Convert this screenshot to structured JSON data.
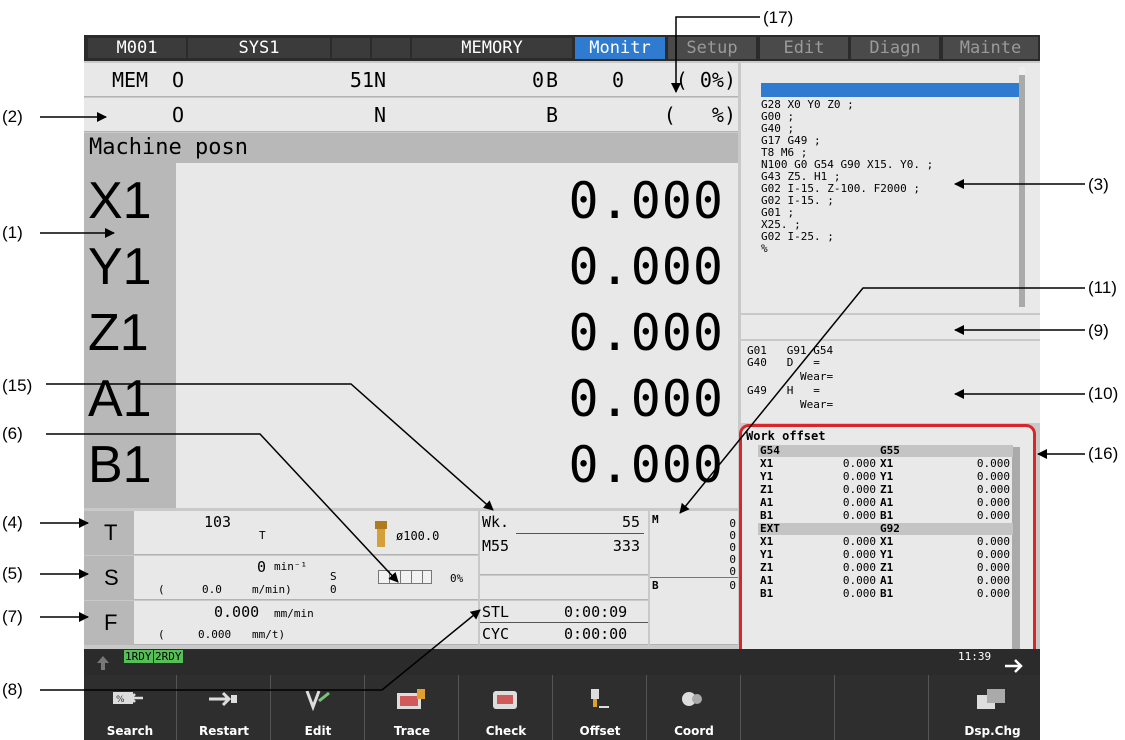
{
  "callouts": [
    "(1)",
    "(2)",
    "(3)",
    "(4)",
    "(5)",
    "(6)",
    "(7)",
    "(8)",
    "(9)",
    "(10)",
    "(11)",
    "(15)",
    "(16)",
    "(17)"
  ],
  "topbar": {
    "machine": "M001",
    "system": "SYS1",
    "mode": "MEMORY",
    "tabs": [
      "Monitr",
      "Setup",
      "Edit",
      "Diagn",
      "Mainte"
    ],
    "active_tab": "Monitr"
  },
  "program_rows": [
    {
      "label": "MEM",
      "o_label": "O",
      "o_value": "51",
      "n_label": "N",
      "n_value": "0",
      "b_label": "B",
      "b_value": "0",
      "pct": "( 0%)"
    },
    {
      "label": "",
      "o_label": "O",
      "o_value": "",
      "n_label": "N",
      "n_value": "",
      "b_label": "B",
      "b_value": "",
      "pct": "(   %)"
    }
  ],
  "position": {
    "title": "Machine posn",
    "axes": [
      {
        "name": "X1",
        "value": "0.000"
      },
      {
        "name": "Y1",
        "value": "0.000"
      },
      {
        "name": "Z1",
        "value": "0.000"
      },
      {
        "name": "A1",
        "value": "0.000"
      },
      {
        "name": "B1",
        "value": "0.000"
      }
    ]
  },
  "tool": {
    "label": "T",
    "value": "103",
    "sub": "T",
    "diameter": "ø100.0"
  },
  "spindle": {
    "label": "S",
    "value": "0",
    "unit": "min⁻¹",
    "paren": "(",
    "speed": "0.0",
    "speed_unit": "m/min)",
    "s_sub": "S",
    "s_val": "0",
    "load_pct": "0%",
    "load_fraction": 0.0
  },
  "feed": {
    "label": "F",
    "value": "0.000",
    "unit": "mm/min",
    "paren": "(",
    "per_rev": "0.000",
    "per_rev_unit": "mm/t)"
  },
  "counters": {
    "wk_label": "Wk.",
    "wk_value": "55",
    "m55_label": "M55",
    "m55_value": "333"
  },
  "mcodes": {
    "m_label": "M",
    "b_label": "B",
    "m_values": [
      "0",
      "0",
      "0",
      "0",
      "0"
    ],
    "b_value": "0"
  },
  "time": {
    "stl_label": "STL",
    "stl_value": "0:00:09",
    "cyc_label": "CYC",
    "cyc_value": "0:00:00"
  },
  "status": {
    "ready1": "1RDY",
    "ready2": "2RDY",
    "clock": "11:39"
  },
  "program_lines": [
    "G28 X0 Y0 Z0 ;",
    "G00 ;",
    "G40 ;",
    "G17 G49 ;",
    "T8 M6 ;",
    "N100 G0 G54 G90 X15. Y0. ;",
    "G43 Z5. H1 ;",
    "G02 I-15. Z-100. F2000 ;",
    "G02 I-15. ;",
    "G01 ;",
    "X25. ;",
    "G02 I-25. ;",
    "%"
  ],
  "modal": {
    "line1": "G01   G91 G54",
    "line2": "G40   D   =",
    "line3": "        Wear=",
    "line4": "G49   H   =",
    "line5": "        Wear="
  },
  "work_offset": {
    "title": "Work offset",
    "groups": [
      {
        "left": "G54",
        "right": "G55",
        "rows": [
          [
            "X1",
            "0.000",
            "X1",
            "0.000"
          ],
          [
            "Y1",
            "0.000",
            "Y1",
            "0.000"
          ],
          [
            "Z1",
            "0.000",
            "Z1",
            "0.000"
          ],
          [
            "A1",
            "0.000",
            "A1",
            "0.000"
          ],
          [
            "B1",
            "0.000",
            "B1",
            "0.000"
          ]
        ]
      },
      {
        "left": "EXT",
        "right": "G92",
        "rows": [
          [
            "X1",
            "0.000",
            "X1",
            "0.000"
          ],
          [
            "Y1",
            "0.000",
            "Y1",
            "0.000"
          ],
          [
            "Z1",
            "0.000",
            "Z1",
            "0.000"
          ],
          [
            "A1",
            "0.000",
            "A1",
            "0.000"
          ],
          [
            "B1",
            "0.000",
            "B1",
            "0.000"
          ]
        ]
      }
    ]
  },
  "softkeys": [
    "Search",
    "Restart",
    "Edit",
    "Trace",
    "Check",
    "Offset",
    "Coord",
    "",
    "",
    "Dsp.Chg"
  ],
  "colors": {
    "active_tab": "#2f7bd0",
    "highlight_bar": "#2f7bd0",
    "work_offset_border": "#d9262a",
    "ready": "#4fc84f"
  }
}
